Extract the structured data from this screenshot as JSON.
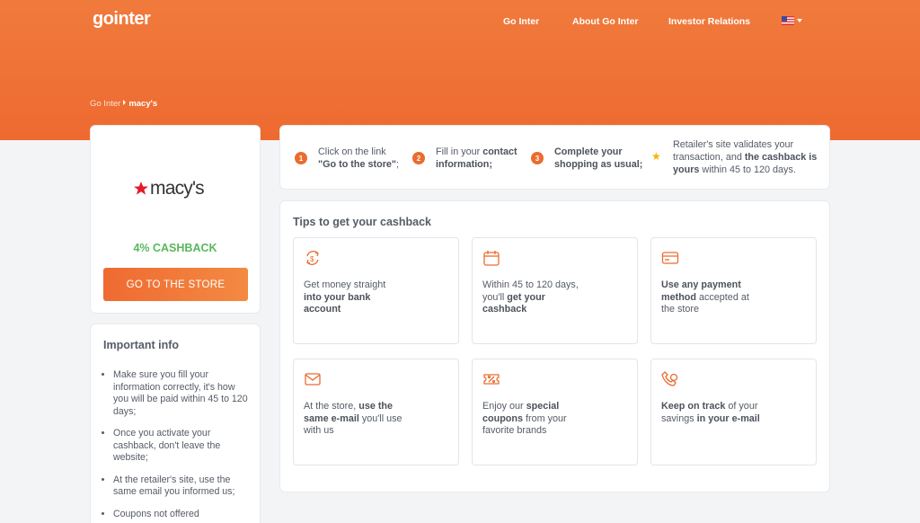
{
  "header": {
    "logo": "gointer",
    "nav": [
      "Go Inter",
      "About Go Inter",
      "Investor Relations"
    ],
    "language_flag": "us-flag-icon"
  },
  "breadcrumb": {
    "home": "Go Inter",
    "current": "macy's"
  },
  "store": {
    "name": "macy's",
    "cashback": "4% CASHBACK",
    "button": "GO TO THE STORE"
  },
  "important_info": {
    "title": "Important info",
    "items": [
      "Make sure you fill your information correctly, it's how you will be paid within 45 to 120 days;",
      "Once you activate your cashback, don't leave the website;",
      "At the retailer's site, use the same email you informed us;",
      "Coupons not offered"
    ]
  },
  "steps": [
    {
      "num": "1",
      "a": "Click on the link",
      "b": "\"Go to the store\"",
      "c": ";"
    },
    {
      "num": "2",
      "a": "Fill in your ",
      "b": "contact information;",
      "c": ""
    },
    {
      "num": "3",
      "a": "",
      "b": "Complete your shopping as usual;",
      "c": ""
    },
    {
      "num": "★",
      "a": "Retailer's site validates your transaction, and ",
      "b": "the cashback is yours",
      "c": " within 45 to 120 days."
    }
  ],
  "tips": {
    "title": "Tips to get your cashback",
    "items": [
      {
        "icon": "money-exchange-icon",
        "pre": "Get money straight ",
        "bold": "into your bank account",
        "post": ""
      },
      {
        "icon": "calendar-icon",
        "pre": "Within 45 to 120 days, you'll ",
        "bold": "get your cashback",
        "post": ""
      },
      {
        "icon": "credit-card-icon",
        "pre": "",
        "bold": "Use any payment method",
        "post": " accepted at the store"
      },
      {
        "icon": "envelope-icon",
        "pre": "At the store, ",
        "bold": "use the same e-mail",
        "post": " you'll use with us"
      },
      {
        "icon": "coupon-icon",
        "pre": "Enjoy our ",
        "bold": "special coupons",
        "post": " from your favorite brands"
      },
      {
        "icon": "tracking-icon",
        "pre": "",
        "bold": "Keep on track",
        "post": " of your savings ",
        "bold2": "in your e-mail"
      }
    ]
  },
  "colors": {
    "accent": "#ee6a30",
    "cashback": "#58b85c",
    "star": "#f5b400"
  }
}
